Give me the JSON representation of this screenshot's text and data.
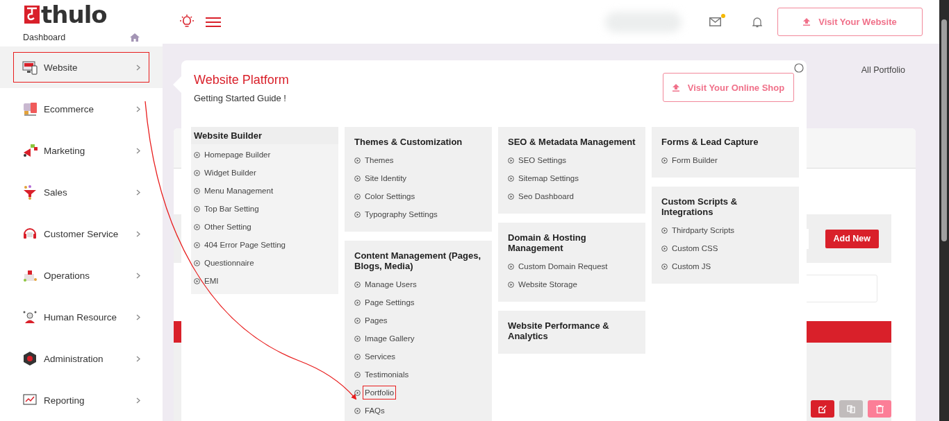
{
  "logo": {
    "text": "thulo"
  },
  "sidebar": {
    "dashboard": "Dashboard",
    "items": [
      {
        "label": "Website",
        "selected": true,
        "highlighted": true
      },
      {
        "label": "Ecommerce",
        "selected": false,
        "highlighted": false
      },
      {
        "label": "Marketing",
        "selected": false,
        "highlighted": false
      },
      {
        "label": "Sales",
        "selected": false,
        "highlighted": false
      },
      {
        "label": "Customer Service",
        "selected": false,
        "highlighted": false
      },
      {
        "label": "Operations",
        "selected": false,
        "highlighted": false
      },
      {
        "label": "Human Resource",
        "selected": false,
        "highlighted": false
      },
      {
        "label": "Administration",
        "selected": false,
        "highlighted": false
      },
      {
        "label": "Reporting",
        "selected": false,
        "highlighted": false
      }
    ]
  },
  "topbar": {
    "button": "Visit Your Website",
    "mail_unread": true
  },
  "page": {
    "title": "All Portfolio",
    "add_button": "Add New"
  },
  "popup": {
    "title": "Website Platform",
    "subtitle": "Getting Started Guide !",
    "button": "Visit Your Online Shop",
    "columns": [
      {
        "sections": [
          {
            "title": "Website Builder",
            "links": [
              {
                "label": "Homepage Builder",
                "highlighted": false
              },
              {
                "label": "Widget Builder",
                "highlighted": false
              },
              {
                "label": "Menu Management",
                "highlighted": false
              },
              {
                "label": "Top Bar Setting",
                "highlighted": false
              },
              {
                "label": "Other Setting",
                "highlighted": false
              },
              {
                "label": "404 Error Page Setting",
                "highlighted": false
              },
              {
                "label": "Questionnaire",
                "highlighted": false
              },
              {
                "label": "EMI",
                "highlighted": false
              }
            ]
          }
        ]
      },
      {
        "sections": [
          {
            "title": "Themes & Customization",
            "links": [
              {
                "label": "Themes",
                "highlighted": false
              },
              {
                "label": "Site Identity",
                "highlighted": false
              },
              {
                "label": "Color Settings",
                "highlighted": false
              },
              {
                "label": "Typography Settings",
                "highlighted": false
              }
            ]
          },
          {
            "title": "Content Management (Pages, Blogs, Media)",
            "links": [
              {
                "label": "Manage Users",
                "highlighted": false
              },
              {
                "label": "Page Settings",
                "highlighted": false
              },
              {
                "label": "Pages",
                "highlighted": false
              },
              {
                "label": "Image Gallery",
                "highlighted": false
              },
              {
                "label": "Services",
                "highlighted": false
              },
              {
                "label": "Testimonials",
                "highlighted": false
              },
              {
                "label": "Portfolio",
                "highlighted": true
              },
              {
                "label": "FAQs",
                "highlighted": false
              }
            ]
          }
        ]
      },
      {
        "sections": [
          {
            "title": "SEO & Metadata Management",
            "links": [
              {
                "label": "SEO Settings",
                "highlighted": false
              },
              {
                "label": "Sitemap Settings",
                "highlighted": false
              },
              {
                "label": "Seo Dashboard",
                "highlighted": false
              }
            ]
          },
          {
            "title": "Domain & Hosting Management",
            "links": [
              {
                "label": "Custom Domain Request",
                "highlighted": false
              },
              {
                "label": "Website Storage",
                "highlighted": false
              }
            ]
          },
          {
            "title": "Website Performance & Analytics"
          }
        ]
      },
      {
        "sections": [
          {
            "title": "Forms & Lead Capture",
            "links": [
              {
                "label": "Form Builder",
                "highlighted": false
              }
            ]
          },
          {
            "title": "Custom Scripts & Integrations",
            "links": [
              {
                "label": "Thirdparty Scripts",
                "highlighted": false
              },
              {
                "label": "Custom CSS",
                "highlighted": false
              },
              {
                "label": "Custom JS",
                "highlighted": false
              }
            ]
          }
        ]
      }
    ]
  }
}
